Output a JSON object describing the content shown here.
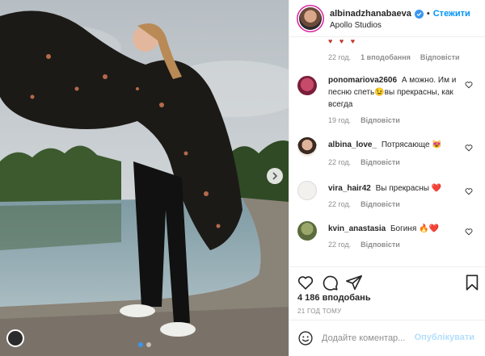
{
  "post": {
    "username": "albinadzhanabaeva",
    "separator": "•",
    "follow_label": "Стежити",
    "location": "Apollo Studios",
    "more_icon": "more-icon"
  },
  "comments": [
    {
      "username": "ponomariova2606",
      "text": "А можно. Им и песню спеть😉вы прекрасны, как всегда",
      "time": "19 год.",
      "likes": "",
      "reply": "Відповісти"
    },
    {
      "username": "albina_love_",
      "text": "Потрясающе 😻",
      "time": "22 год.",
      "likes": "",
      "reply": "Відповісти"
    },
    {
      "username": "vira_hair42",
      "text": "Вы прекрасны ❤️",
      "time": "22 год.",
      "likes": "",
      "reply": "Відповісти"
    },
    {
      "username": "kvin_anastasia",
      "text": "Богиня 🔥❤️",
      "time": "22 год.",
      "likes": "",
      "reply": "Відповісти"
    }
  ],
  "top_meta": {
    "time": "22 год.",
    "likes": "1 вподобання",
    "reply": "Відповісти"
  },
  "likes_count": "4 186 вподобань",
  "time_ago": "21 ГОД ТОМУ",
  "add_comment": {
    "placeholder": "Додайте коментар...",
    "publish_label": "Опублікувати"
  },
  "colors": {
    "accent": "#0095f6",
    "publish_disabled": "#b2dffc",
    "muted_text": "#8e8e8e"
  }
}
